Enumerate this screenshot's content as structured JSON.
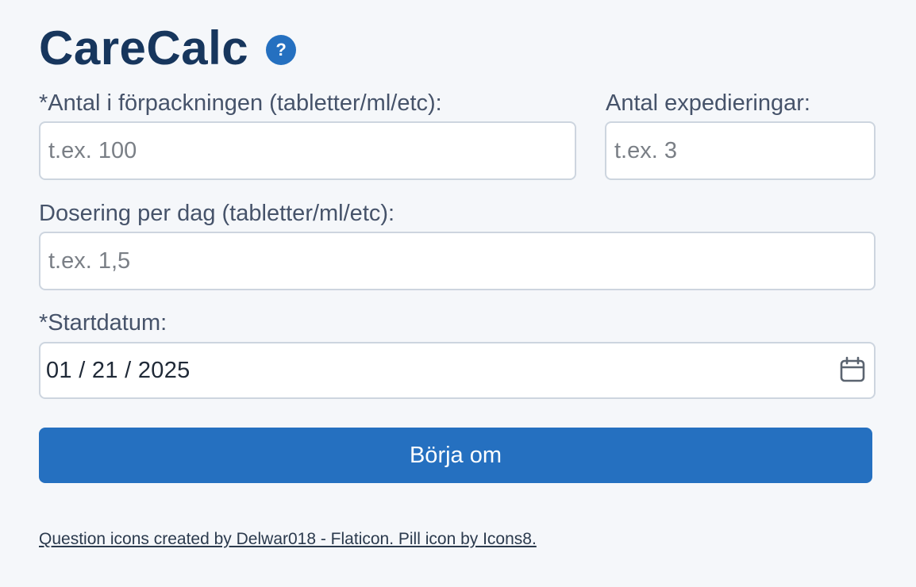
{
  "app": {
    "title": "CareCalc",
    "help_icon_glyph": "?"
  },
  "form": {
    "package_quantity": {
      "label": "*Antal i förpackningen (tabletter/ml/etc):",
      "placeholder": "t.ex. 100",
      "value": ""
    },
    "dispensings": {
      "label": "Antal expedieringar:",
      "placeholder": "t.ex. 3",
      "value": ""
    },
    "daily_dose": {
      "label": "Dosering per dag (tabletter/ml/etc):",
      "placeholder": "t.ex. 1,5",
      "value": ""
    },
    "start_date": {
      "label": "*Startdatum:",
      "value": "01 / 21 / 2025"
    },
    "reset_button": {
      "label": "Börja om"
    }
  },
  "footer": {
    "credits": "Question icons created by Delwar018 - Flaticon. Pill icon by Icons8."
  },
  "icons": {
    "help": "question-circle-icon",
    "calendar": "calendar-icon"
  },
  "colors": {
    "brand_title": "#17365d",
    "accent": "#2570c0",
    "background": "#f5f7fa",
    "field_border": "#cdd5df"
  }
}
